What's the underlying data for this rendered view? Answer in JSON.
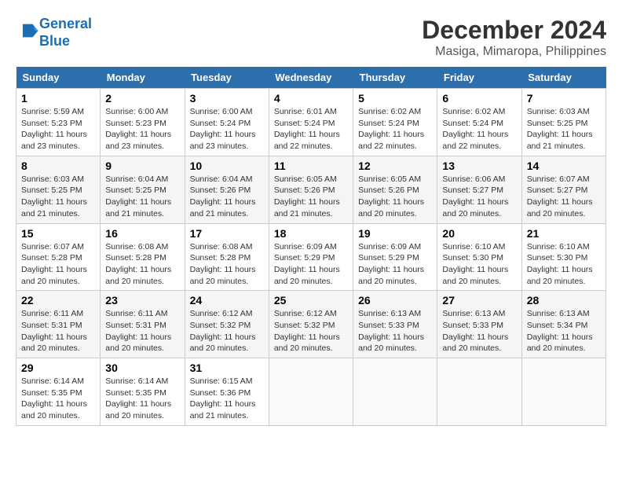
{
  "logo": {
    "line1": "General",
    "line2": "Blue"
  },
  "title": "December 2024",
  "location": "Masiga, Mimaropa, Philippines",
  "days_of_week": [
    "Sunday",
    "Monday",
    "Tuesday",
    "Wednesday",
    "Thursday",
    "Friday",
    "Saturday"
  ],
  "weeks": [
    [
      {
        "day": "1",
        "info": "Sunrise: 5:59 AM\nSunset: 5:23 PM\nDaylight: 11 hours\nand 23 minutes."
      },
      {
        "day": "2",
        "info": "Sunrise: 6:00 AM\nSunset: 5:23 PM\nDaylight: 11 hours\nand 23 minutes."
      },
      {
        "day": "3",
        "info": "Sunrise: 6:00 AM\nSunset: 5:24 PM\nDaylight: 11 hours\nand 23 minutes."
      },
      {
        "day": "4",
        "info": "Sunrise: 6:01 AM\nSunset: 5:24 PM\nDaylight: 11 hours\nand 22 minutes."
      },
      {
        "day": "5",
        "info": "Sunrise: 6:02 AM\nSunset: 5:24 PM\nDaylight: 11 hours\nand 22 minutes."
      },
      {
        "day": "6",
        "info": "Sunrise: 6:02 AM\nSunset: 5:24 PM\nDaylight: 11 hours\nand 22 minutes."
      },
      {
        "day": "7",
        "info": "Sunrise: 6:03 AM\nSunset: 5:25 PM\nDaylight: 11 hours\nand 21 minutes."
      }
    ],
    [
      {
        "day": "8",
        "info": "Sunrise: 6:03 AM\nSunset: 5:25 PM\nDaylight: 11 hours\nand 21 minutes."
      },
      {
        "day": "9",
        "info": "Sunrise: 6:04 AM\nSunset: 5:25 PM\nDaylight: 11 hours\nand 21 minutes."
      },
      {
        "day": "10",
        "info": "Sunrise: 6:04 AM\nSunset: 5:26 PM\nDaylight: 11 hours\nand 21 minutes."
      },
      {
        "day": "11",
        "info": "Sunrise: 6:05 AM\nSunset: 5:26 PM\nDaylight: 11 hours\nand 21 minutes."
      },
      {
        "day": "12",
        "info": "Sunrise: 6:05 AM\nSunset: 5:26 PM\nDaylight: 11 hours\nand 20 minutes."
      },
      {
        "day": "13",
        "info": "Sunrise: 6:06 AM\nSunset: 5:27 PM\nDaylight: 11 hours\nand 20 minutes."
      },
      {
        "day": "14",
        "info": "Sunrise: 6:07 AM\nSunset: 5:27 PM\nDaylight: 11 hours\nand 20 minutes."
      }
    ],
    [
      {
        "day": "15",
        "info": "Sunrise: 6:07 AM\nSunset: 5:28 PM\nDaylight: 11 hours\nand 20 minutes."
      },
      {
        "day": "16",
        "info": "Sunrise: 6:08 AM\nSunset: 5:28 PM\nDaylight: 11 hours\nand 20 minutes."
      },
      {
        "day": "17",
        "info": "Sunrise: 6:08 AM\nSunset: 5:28 PM\nDaylight: 11 hours\nand 20 minutes."
      },
      {
        "day": "18",
        "info": "Sunrise: 6:09 AM\nSunset: 5:29 PM\nDaylight: 11 hours\nand 20 minutes."
      },
      {
        "day": "19",
        "info": "Sunrise: 6:09 AM\nSunset: 5:29 PM\nDaylight: 11 hours\nand 20 minutes."
      },
      {
        "day": "20",
        "info": "Sunrise: 6:10 AM\nSunset: 5:30 PM\nDaylight: 11 hours\nand 20 minutes."
      },
      {
        "day": "21",
        "info": "Sunrise: 6:10 AM\nSunset: 5:30 PM\nDaylight: 11 hours\nand 20 minutes."
      }
    ],
    [
      {
        "day": "22",
        "info": "Sunrise: 6:11 AM\nSunset: 5:31 PM\nDaylight: 11 hours\nand 20 minutes."
      },
      {
        "day": "23",
        "info": "Sunrise: 6:11 AM\nSunset: 5:31 PM\nDaylight: 11 hours\nand 20 minutes."
      },
      {
        "day": "24",
        "info": "Sunrise: 6:12 AM\nSunset: 5:32 PM\nDaylight: 11 hours\nand 20 minutes."
      },
      {
        "day": "25",
        "info": "Sunrise: 6:12 AM\nSunset: 5:32 PM\nDaylight: 11 hours\nand 20 minutes."
      },
      {
        "day": "26",
        "info": "Sunrise: 6:13 AM\nSunset: 5:33 PM\nDaylight: 11 hours\nand 20 minutes."
      },
      {
        "day": "27",
        "info": "Sunrise: 6:13 AM\nSunset: 5:33 PM\nDaylight: 11 hours\nand 20 minutes."
      },
      {
        "day": "28",
        "info": "Sunrise: 6:13 AM\nSunset: 5:34 PM\nDaylight: 11 hours\nand 20 minutes."
      }
    ],
    [
      {
        "day": "29",
        "info": "Sunrise: 6:14 AM\nSunset: 5:35 PM\nDaylight: 11 hours\nand 20 minutes."
      },
      {
        "day": "30",
        "info": "Sunrise: 6:14 AM\nSunset: 5:35 PM\nDaylight: 11 hours\nand 20 minutes."
      },
      {
        "day": "31",
        "info": "Sunrise: 6:15 AM\nSunset: 5:36 PM\nDaylight: 11 hours\nand 21 minutes."
      },
      {
        "day": "",
        "info": ""
      },
      {
        "day": "",
        "info": ""
      },
      {
        "day": "",
        "info": ""
      },
      {
        "day": "",
        "info": ""
      }
    ]
  ]
}
